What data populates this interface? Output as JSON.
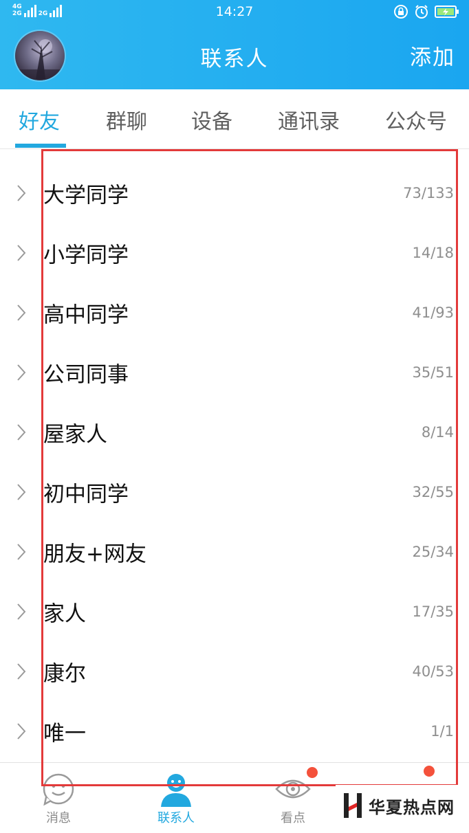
{
  "status_bar": {
    "network_top": "4G",
    "network_bottom": "2G",
    "network_right": "2G",
    "time": "14:27",
    "icons": [
      "lock-rotation-icon",
      "alarm-icon",
      "battery-charging-icon"
    ]
  },
  "header": {
    "title": "联系人",
    "add_label": "添加"
  },
  "tabs": [
    {
      "label": "好友",
      "active": true
    },
    {
      "label": "群聊",
      "active": false
    },
    {
      "label": "设备",
      "active": false
    },
    {
      "label": "通讯录",
      "active": false
    },
    {
      "label": "公众号",
      "active": false
    }
  ],
  "groups": [
    {
      "name": "大学同学",
      "count": "73/133"
    },
    {
      "name": "小学同学",
      "count": "14/18"
    },
    {
      "name": "高中同学",
      "count": "41/93"
    },
    {
      "name": "公司同事",
      "count": "35/51"
    },
    {
      "name": "屋家人",
      "count": "8/14"
    },
    {
      "name": "初中同学",
      "count": "32/55"
    },
    {
      "name": "朋友+网友",
      "count": "25/34"
    },
    {
      "name": "家人",
      "count": "17/35"
    },
    {
      "name": "康尔",
      "count": "40/53"
    },
    {
      "name": "唯一",
      "count": "1/1"
    }
  ],
  "bottom_nav": [
    {
      "label": "消息",
      "icon": "message-smile-icon",
      "active": false
    },
    {
      "label": "联系人",
      "icon": "contacts-person-icon",
      "active": true
    },
    {
      "label": "看点",
      "icon": "eye-icon",
      "active": false,
      "badge": true
    }
  ],
  "watermark": {
    "text": "华夏热点网"
  },
  "colors": {
    "header_blue": "#1aa6f0",
    "accent": "#22a8df",
    "badge_red": "#f4513b",
    "highlight_red": "#e33a3a"
  }
}
